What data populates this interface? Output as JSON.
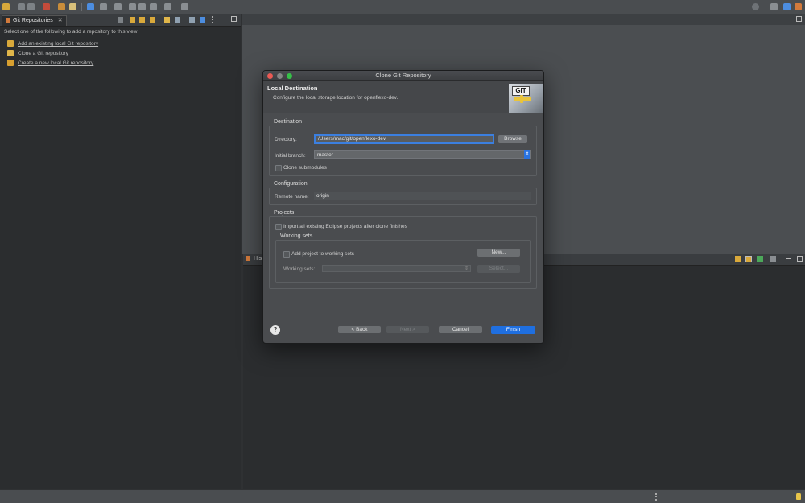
{
  "leftview": {
    "tab_label": "Git Repositories",
    "prompt": "Select one of the following to add a repository to this view:",
    "links": [
      {
        "label": "Add an existing local Git repository",
        "icon": "add-repo-icon"
      },
      {
        "label": "Clone a Git repository",
        "icon": "clone-repo-icon"
      },
      {
        "label": "Create a new local Git repository",
        "icon": "create-repo-icon"
      }
    ]
  },
  "bottompanel": {
    "tab_label": "His"
  },
  "dialog": {
    "title": "Clone Git Repository",
    "header_title": "Local Destination",
    "header_subtitle": "Configure the local storage location for openflexo-dev.",
    "logo_text": "GIT",
    "destination": {
      "group_title": "Destination",
      "directory_label": "Directory:",
      "directory_value": "/Users/mac/git/openflexo-dev",
      "browse_label": "Browse",
      "branch_label": "Initial branch:",
      "branch_value": "master",
      "submodules_label": "Clone submodules"
    },
    "configuration": {
      "group_title": "Configuration",
      "remote_label": "Remote name:",
      "remote_value": "origin"
    },
    "projects": {
      "group_title": "Projects",
      "import_label": "Import all existing Eclipse projects after clone finishes",
      "working_sets_title": "Working sets",
      "add_label": "Add project to working sets",
      "new_label": "New...",
      "sets_label": "Working sets:",
      "select_label": "Select..."
    },
    "buttons": {
      "back": "< Back",
      "next": "Next >",
      "cancel": "Cancel",
      "finish": "Finish"
    }
  },
  "colors": {
    "accent": "#1f6fe0",
    "dialog_bg": "#4a4c4f",
    "ide_bg": "#2b2d2f"
  }
}
